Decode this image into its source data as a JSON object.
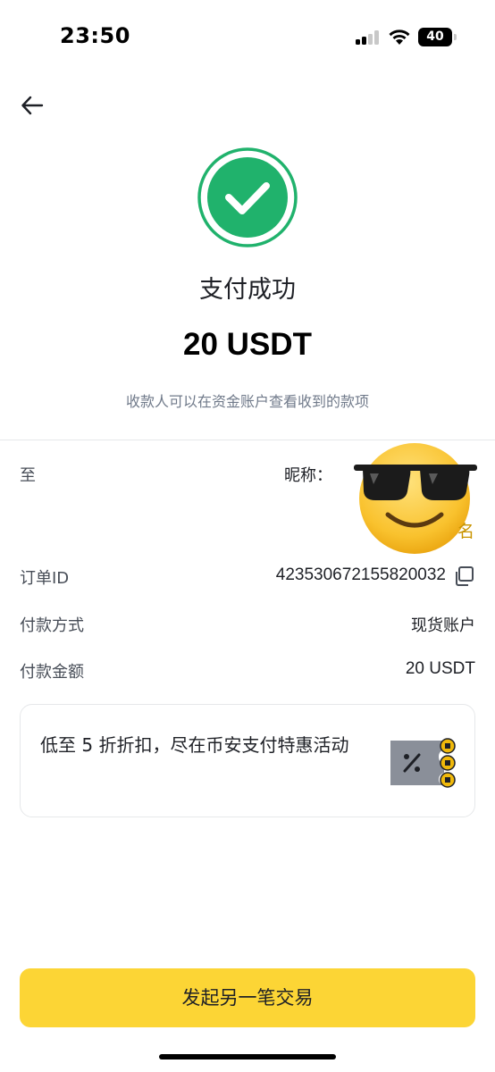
{
  "status_bar": {
    "time": "23:50",
    "battery": "40"
  },
  "header": {
    "back_icon": "arrow-left-icon"
  },
  "result": {
    "icon": "check-circle-icon",
    "title": "支付成功",
    "amount": "20 USDT",
    "notice": "收款人可以在资金账户查看收到的款项"
  },
  "details": {
    "to_label": "至",
    "nickname_label": "昵称：",
    "name_fragment": "名",
    "order_label": "订单ID",
    "order_value": "423530672155820032",
    "method_label": "付款方式",
    "method_value": "现货账户",
    "amount_label": "付款金额",
    "amount_value": "20 USDT"
  },
  "promo": {
    "text": "低至 5 折折扣，尽在币安支付特惠活动",
    "graphic": "coupon-icon"
  },
  "cta": {
    "label": "发起另一笔交易"
  },
  "colors": {
    "accent": "#FCD535",
    "success": "#20B26C",
    "secondary_text": "#707A8A"
  }
}
